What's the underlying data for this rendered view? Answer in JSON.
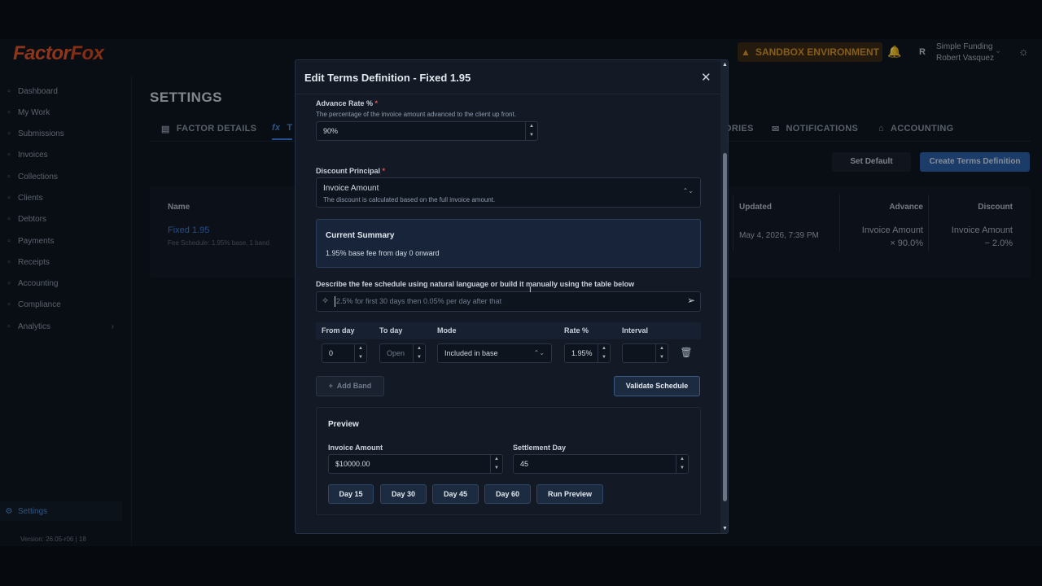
{
  "header": {
    "logo": "FactorFox",
    "logo_a": "Factor",
    "logo_b": "Fox",
    "sandbox_label": "SANDBOX ENVIRONMENT",
    "avatar_initial": "R",
    "company": "Simple Funding",
    "user": "Robert Vasquez"
  },
  "sidebar": {
    "items": [
      {
        "label": "Dashboard"
      },
      {
        "label": "My Work"
      },
      {
        "label": "Submissions"
      },
      {
        "label": "Invoices"
      },
      {
        "label": "Collections"
      },
      {
        "label": "Clients"
      },
      {
        "label": "Debtors"
      },
      {
        "label": "Payments"
      },
      {
        "label": "Receipts"
      },
      {
        "label": "Accounting"
      },
      {
        "label": "Compliance"
      },
      {
        "label": "Analytics"
      },
      {
        "label": "Settings"
      }
    ],
    "version": "Version: 26.05-r06 | 18"
  },
  "settings": {
    "title": "SETTINGS",
    "tabs": [
      {
        "label": "FACTOR DETAILS"
      },
      {
        "label": "T"
      },
      {
        "label": "ORIES"
      },
      {
        "label": "NOTIFICATIONS"
      },
      {
        "label": "ACCOUNTING"
      }
    ],
    "set_default": "Set Default",
    "create": "Create Terms Definition",
    "table": {
      "headers": {
        "name": "Name",
        "updated": "Updated",
        "advance": "Advance",
        "discount": "Discount"
      },
      "row": {
        "name": "Fixed 1.95",
        "sub": "Fee Schedule: 1.95% base, 1 band",
        "updated": "May 4, 2026, 7:39 PM",
        "advance_1": "Invoice Amount",
        "advance_2": "× 90.0%",
        "discount_1": "Invoice Amount",
        "discount_2": "− 2.0%"
      }
    }
  },
  "modal": {
    "title": "Edit Terms Definition - Fixed 1.95",
    "advance_rate": {
      "label": "Advance Rate %",
      "required": "*",
      "hint": "The percentage of the invoice amount advanced to the client up front.",
      "value": "90%"
    },
    "discount_principal": {
      "label": "Discount Principal",
      "required": "*",
      "value": "Invoice Amount",
      "description": "The discount is calculated based on the full invoice amount."
    },
    "summary": {
      "title": "Current Summary",
      "text": "1.95% base fee from day 0 onward"
    },
    "nl": {
      "label": "Describe the fee schedule using natural language or build it manually using the table below",
      "placeholder": "2.5% for first 30 days then 0.05% per day after that"
    },
    "bands": {
      "headers": {
        "from": "From day",
        "to": "To day",
        "mode": "Mode",
        "rate": "Rate %",
        "interval": "Interval"
      },
      "row": {
        "from": "0",
        "to_placeholder": "Open",
        "mode": "Included in base",
        "rate": "1.95%",
        "interval": ""
      }
    },
    "add_band": "Add Band",
    "validate": "Validate Schedule",
    "preview": {
      "title": "Preview",
      "invoice_label": "Invoice Amount",
      "invoice_value": "$10000.00",
      "settlement_label": "Settlement Day",
      "settlement_value": "45",
      "buttons": [
        "Day 15",
        "Day 30",
        "Day 45",
        "Day 60",
        "Run Preview"
      ]
    }
  },
  "icons": {
    "close": "close-icon",
    "bell": "bell-icon",
    "sun": "sun-icon",
    "sparkle": "sparkle-icon",
    "send": "send-icon",
    "trash": "trash-icon"
  },
  "colors": {
    "accent": "#3b7ddd",
    "brand": "#e4572e",
    "sandbox": "#d9962d",
    "required": "#e05252"
  }
}
